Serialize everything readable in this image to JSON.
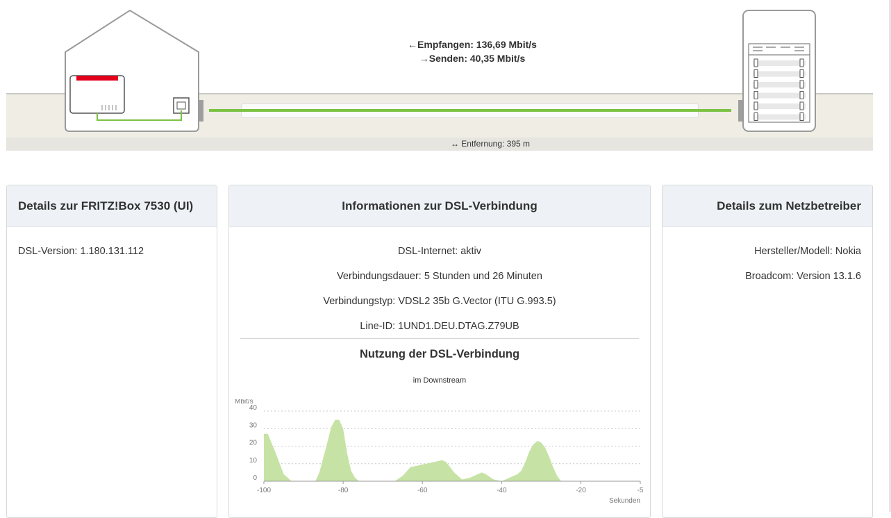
{
  "connection": {
    "receive_arrow": "←",
    "receive_text": "Empfangen: 136,69 Mbit/s",
    "send_arrow": "→",
    "send_text": "Senden: 40,35 Mbit/s",
    "distance_arrow": "↔",
    "distance_text": "Entfernung: 395 m"
  },
  "colors": {
    "accent_green": "#7cc243",
    "area_fill": "#c6e3a5",
    "fritz_red": "#e2001a",
    "header_bg": "#eef2f7"
  },
  "panels": {
    "left": {
      "title": "Details zur FRITZ!Box 7530 (UI)",
      "lines": [
        "DSL-Version: 1.180.131.112"
      ]
    },
    "middle": {
      "title": "Informationen zur DSL-Verbindung",
      "lines": [
        "DSL-Internet: aktiv",
        "Verbindungsdauer: 5 Stunden und 26 Minuten",
        "Verbindungstyp: VDSL2 35b G.Vector (ITU G.993.5)",
        "Line-ID: 1UND1.DEU.DTAG.Z79UB"
      ],
      "usage_title": "Nutzung der DSL-Verbindung"
    },
    "right": {
      "title": "Details zum Netzbetreiber",
      "lines": [
        "Hersteller/Modell: Nokia",
        "Broadcom: Version 13.1.6"
      ]
    }
  },
  "chart_data": {
    "type": "area",
    "title": "im Downstream",
    "ylabel": "Mbit/s",
    "xlabel": "Sekunden",
    "ylim": [
      0,
      40
    ],
    "xlim": [
      -100,
      -5
    ],
    "yticks": [
      0,
      10,
      20,
      30,
      40
    ],
    "xticks": [
      -100,
      -80,
      -60,
      -40,
      -20,
      -5
    ],
    "grid": true,
    "series": [
      {
        "x": [
          -100,
          -99,
          -97,
          -95,
          -93,
          -92,
          -87,
          -86,
          -84,
          -83,
          -82,
          -81,
          -80,
          -79,
          -78,
          -77,
          -76,
          -73,
          -67,
          -65,
          -63,
          -61,
          -59,
          -57,
          -55,
          -54,
          -53,
          -52,
          -50,
          -48,
          -46,
          -45,
          -44,
          -42,
          -40,
          -39,
          -37,
          -36,
          -35,
          -34,
          -33,
          -32,
          -31,
          -30,
          -29,
          -28,
          -27,
          -26,
          -25,
          -24,
          -23,
          -22,
          -21,
          -20,
          -19,
          -18,
          -17,
          -16,
          -15,
          -14,
          -13,
          -12,
          -11,
          -10,
          -9,
          -8,
          -7,
          -6,
          -5
        ],
        "values": [
          27,
          27,
          16,
          4,
          0,
          0,
          0,
          5,
          22,
          31,
          35,
          35,
          30,
          16,
          6,
          2,
          0,
          0,
          0,
          3,
          8,
          9,
          10,
          11,
          12,
          11,
          8,
          5,
          1,
          2,
          4,
          5,
          4,
          1,
          0,
          1,
          3,
          4,
          6,
          11,
          17,
          21,
          23,
          22,
          19,
          14,
          8,
          3,
          0,
          0,
          0,
          0,
          0,
          0,
          0,
          0,
          0,
          0,
          0,
          0,
          0,
          0,
          0,
          0,
          0,
          0,
          0,
          0,
          0
        ]
      }
    ]
  }
}
